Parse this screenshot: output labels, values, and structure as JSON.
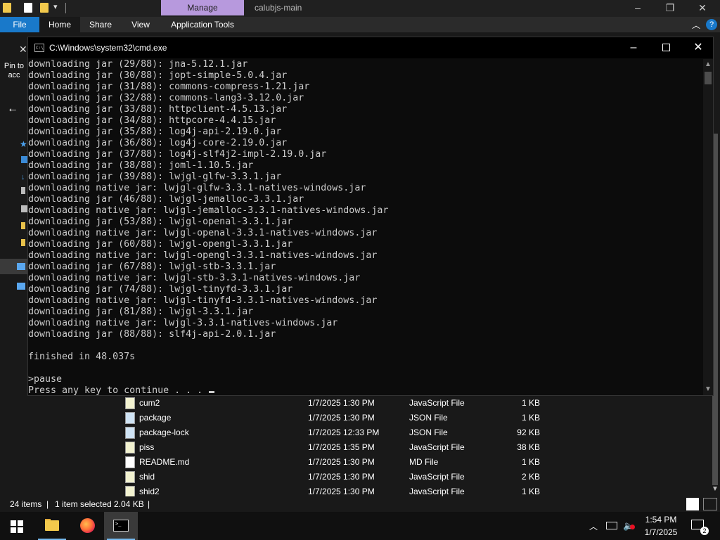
{
  "explorer": {
    "title": "calubjs-main",
    "manage_tab": "Manage",
    "ribbon": {
      "file": "File",
      "home": "Home",
      "share": "Share",
      "view": "View",
      "app_tools": "Application Tools",
      "help": "?"
    },
    "pin_label": "Pin to acc",
    "files": [
      {
        "name": "cum2",
        "date": "1/7/2025 1:30 PM",
        "type": "JavaScript File",
        "size": "1 KB",
        "icon": "js-file-icon"
      },
      {
        "name": "package",
        "date": "1/7/2025 1:30 PM",
        "type": "JSON File",
        "size": "1 KB",
        "icon": "json-file-icon"
      },
      {
        "name": "package-lock",
        "date": "1/7/2025 12:33 PM",
        "type": "JSON File",
        "size": "92 KB",
        "icon": "json-file-icon"
      },
      {
        "name": "piss",
        "date": "1/7/2025 1:35 PM",
        "type": "JavaScript File",
        "size": "38 KB",
        "icon": "js-file-icon"
      },
      {
        "name": "README.md",
        "date": "1/7/2025 1:30 PM",
        "type": "MD File",
        "size": "1 KB",
        "icon": "md-file-icon"
      },
      {
        "name": "shid",
        "date": "1/7/2025 1:30 PM",
        "type": "JavaScript File",
        "size": "2 KB",
        "icon": "js-file-icon"
      },
      {
        "name": "shid2",
        "date": "1/7/2025 1:30 PM",
        "type": "JavaScript File",
        "size": "1 KB",
        "icon": "js-file-icon"
      }
    ],
    "status": {
      "item_count": "24 items",
      "selection": "1 item selected",
      "selection_size": "2.04 KB"
    }
  },
  "cmd": {
    "title": "C:\\Windows\\system32\\cmd.exe",
    "lines": [
      "downloading jar (29/88): jna-5.12.1.jar",
      "downloading jar (30/88): jopt-simple-5.0.4.jar",
      "downloading jar (31/88): commons-compress-1.21.jar",
      "downloading jar (32/88): commons-lang3-3.12.0.jar",
      "downloading jar (33/88): httpclient-4.5.13.jar",
      "downloading jar (34/88): httpcore-4.4.15.jar",
      "downloading jar (35/88): log4j-api-2.19.0.jar",
      "downloading jar (36/88): log4j-core-2.19.0.jar",
      "downloading jar (37/88): log4j-slf4j2-impl-2.19.0.jar",
      "downloading jar (38/88): joml-1.10.5.jar",
      "downloading jar (39/88): lwjgl-glfw-3.3.1.jar",
      "downloading native jar: lwjgl-glfw-3.3.1-natives-windows.jar",
      "downloading jar (46/88): lwjgl-jemalloc-3.3.1.jar",
      "downloading native jar: lwjgl-jemalloc-3.3.1-natives-windows.jar",
      "downloading jar (53/88): lwjgl-openal-3.3.1.jar",
      "downloading native jar: lwjgl-openal-3.3.1-natives-windows.jar",
      "downloading jar (60/88): lwjgl-opengl-3.3.1.jar",
      "downloading native jar: lwjgl-opengl-3.3.1-natives-windows.jar",
      "downloading jar (67/88): lwjgl-stb-3.3.1.jar",
      "downloading native jar: lwjgl-stb-3.3.1-natives-windows.jar",
      "downloading jar (74/88): lwjgl-tinyfd-3.3.1.jar",
      "downloading native jar: lwjgl-tinyfd-3.3.1-natives-windows.jar",
      "downloading jar (81/88): lwjgl-3.3.1.jar",
      "downloading native jar: lwjgl-3.3.1-natives-windows.jar",
      "downloading jar (88/88): slf4j-api-2.0.1.jar",
      "",
      "finished in 48.037s",
      "",
      ">pause",
      "Press any key to continue . . . "
    ]
  },
  "taskbar": {
    "time": "1:54 PM",
    "date": "1/7/2025",
    "notification_count": "2",
    "accent": "#76b9ed"
  },
  "colors": {
    "file_tab": "#1979ca",
    "manage_tab": "#b799dd",
    "console_text": "#cccccc"
  }
}
